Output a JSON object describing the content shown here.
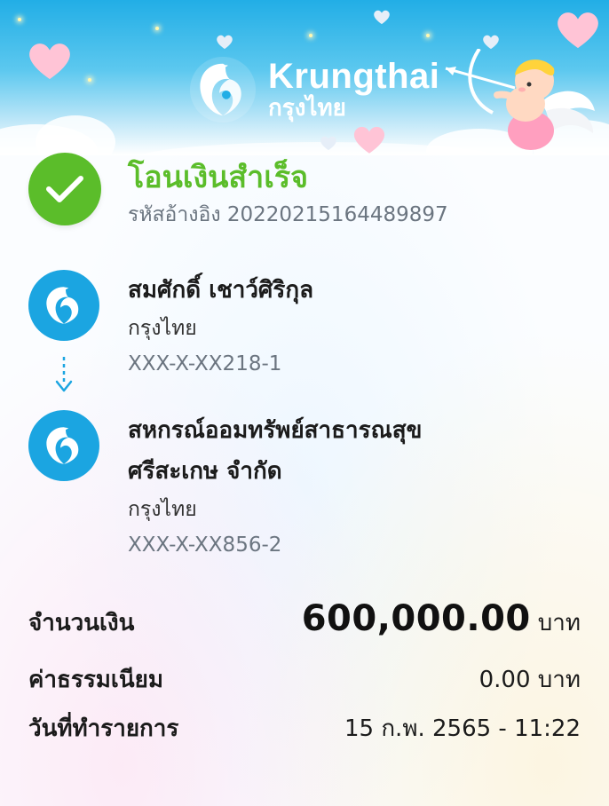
{
  "brand": {
    "name_en": "Krungthai",
    "name_th": "กรุงไทย"
  },
  "status": {
    "title": "โอนเงินสำเร็จ",
    "reference": "รหัสอ้างอิง 2022021516448​9897"
  },
  "sender": {
    "name": "สมศักดิ์ เชาว์ศิริกุล",
    "bank": "กรุงไทย",
    "account": "XXX-X-XX218-1"
  },
  "receiver": {
    "name_line1": "สหกรณ์ออมทรัพย์สาธารณสุข",
    "name_line2": "ศรีสะเกษ จำกัด",
    "bank": "กรุงไทย",
    "account": "XXX-X-XX856-2"
  },
  "details": {
    "amount_label": "จำนวนเงิน",
    "amount_value": "600,000.00",
    "amount_unit": "บาท",
    "fee_label": "ค่าธรรมเนียม",
    "fee_value": "0.00 บาท",
    "date_label": "วันที่ทำรายการ",
    "date_value": "15 ก.พ. 2565 - 11:22"
  },
  "colors": {
    "success": "#5bbd2a",
    "brand_blue": "#1ba5e1",
    "header_top": "#22aee6"
  },
  "icons": {
    "status": "check-icon",
    "bank": "krungthai-bird-icon",
    "transfer": "arrow-down-icon"
  }
}
